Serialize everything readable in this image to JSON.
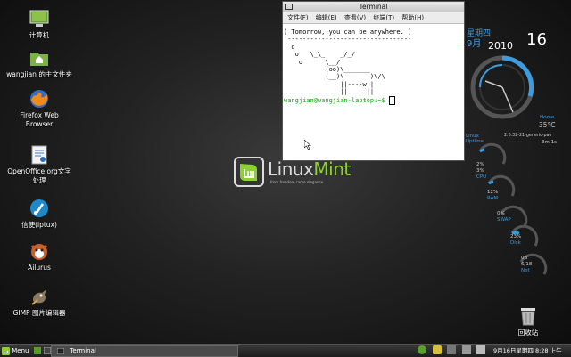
{
  "desktop_icons": [
    {
      "label": "计算机",
      "icon": "computer-icon"
    },
    {
      "label": "wangjian 的主文件夹",
      "icon": "home-folder-icon"
    },
    {
      "label": "Firefox Web Browser",
      "icon": "firefox-icon"
    },
    {
      "label": "OpenOffice.org文字处理",
      "icon": "openoffice-writer-icon"
    },
    {
      "label": "信使(iptux)",
      "icon": "iptux-icon"
    },
    {
      "label": "Ailurus",
      "icon": "ailurus-icon"
    },
    {
      "label": "GIMP 图片编辑器",
      "icon": "gimp-icon"
    }
  ],
  "logo": {
    "word_a": "Linux",
    "word_b": "Mint",
    "tagline": "from freedom came elegance"
  },
  "terminal": {
    "title": "Terminal",
    "menu": [
      "文件(F)",
      "编辑(E)",
      "查看(V)",
      "终端(T)",
      "帮助(H)"
    ],
    "lines": [
      "( Tomorrow, you can be anywhere. )",
      " ---------------------------------",
      "  o",
      "   o   \\_\\_    _/_/",
      "    o      \\__/",
      "           (oo)\\_______",
      "           (__)\\       )\\/\\",
      "               ||----w |",
      "               ||     ||"
    ],
    "prompt": "wangjian@wangjian-laptop:~$ "
  },
  "clock": {
    "weekday": "星期四",
    "month": "9月",
    "year": "2010",
    "day": "16"
  },
  "conky": {
    "home_label": "Home",
    "temp": "35°C",
    "linux_label": "Linux",
    "uptime_label": "Uptime",
    "kernel": "2.6.32-21-generic-pae",
    "uptime": "3m 1s",
    "cpu": [
      "2%",
      "3%"
    ],
    "cpu_label": "CPU",
    "ram": "12%",
    "ram_label": "RAM",
    "swap": "0%",
    "swap_label": "SWAP",
    "disk": "23%",
    "disk_label": "Disk",
    "net": [
      "0B",
      "6/18"
    ],
    "net_label": "Net"
  },
  "trash": {
    "label": "回收站"
  },
  "panel": {
    "menu_label": "Menu",
    "task": "Terminal",
    "datetime": "9月16日星期四  8:28 上午"
  },
  "colors": {
    "accent": "#3b9ce0",
    "mint": "#8bd12f"
  }
}
